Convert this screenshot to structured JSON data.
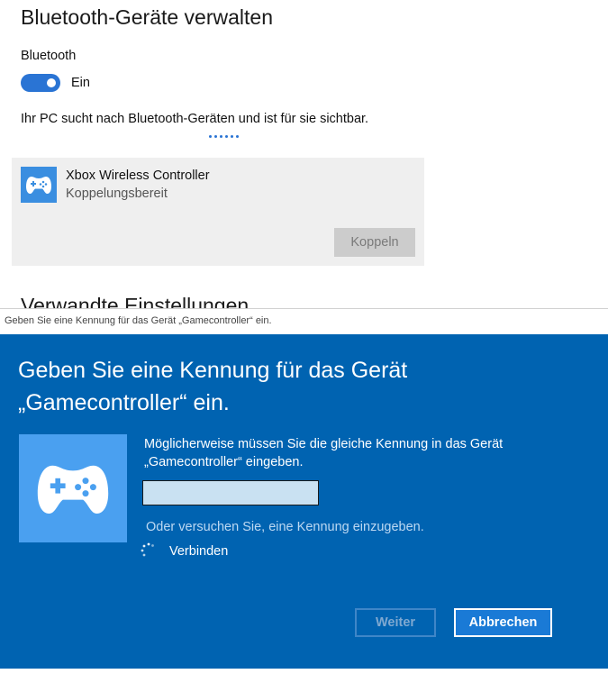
{
  "settings": {
    "title": "Bluetooth-Geräte verwalten",
    "bluetooth_label": "Bluetooth",
    "toggle_state": "Ein",
    "toggle_on": true,
    "search_status": "Ihr PC sucht nach Bluetooth-Geräten und ist für sie sichtbar.",
    "device": {
      "icon": "gamepad-icon",
      "name": "Xbox Wireless Controller",
      "state": "Koppelungsbereit",
      "pair_label": "Koppeln"
    },
    "related_heading": "Verwandte Einstellungen"
  },
  "dialog": {
    "window_title": "Geben Sie eine Kennung für das Gerät „Gamecontroller“ ein.",
    "heading": "Geben Sie eine Kennung für das Gerät „Gamecontroller“ ein.",
    "icon": "gamepad-icon",
    "message": "Möglicherweise müssen Sie die gleiche Kennung in das Gerät „Gamecontroller“ eingeben.",
    "pin_value": "",
    "hint": "Oder versuchen Sie, eine Kennung einzugeben.",
    "progress_label": "Verbinden",
    "next_label": "Weiter",
    "cancel_label": "Abbrechen"
  },
  "colors": {
    "accent": "#0063b1",
    "toggle": "#2a74d4",
    "icon_bg": "#4aa0f0"
  }
}
